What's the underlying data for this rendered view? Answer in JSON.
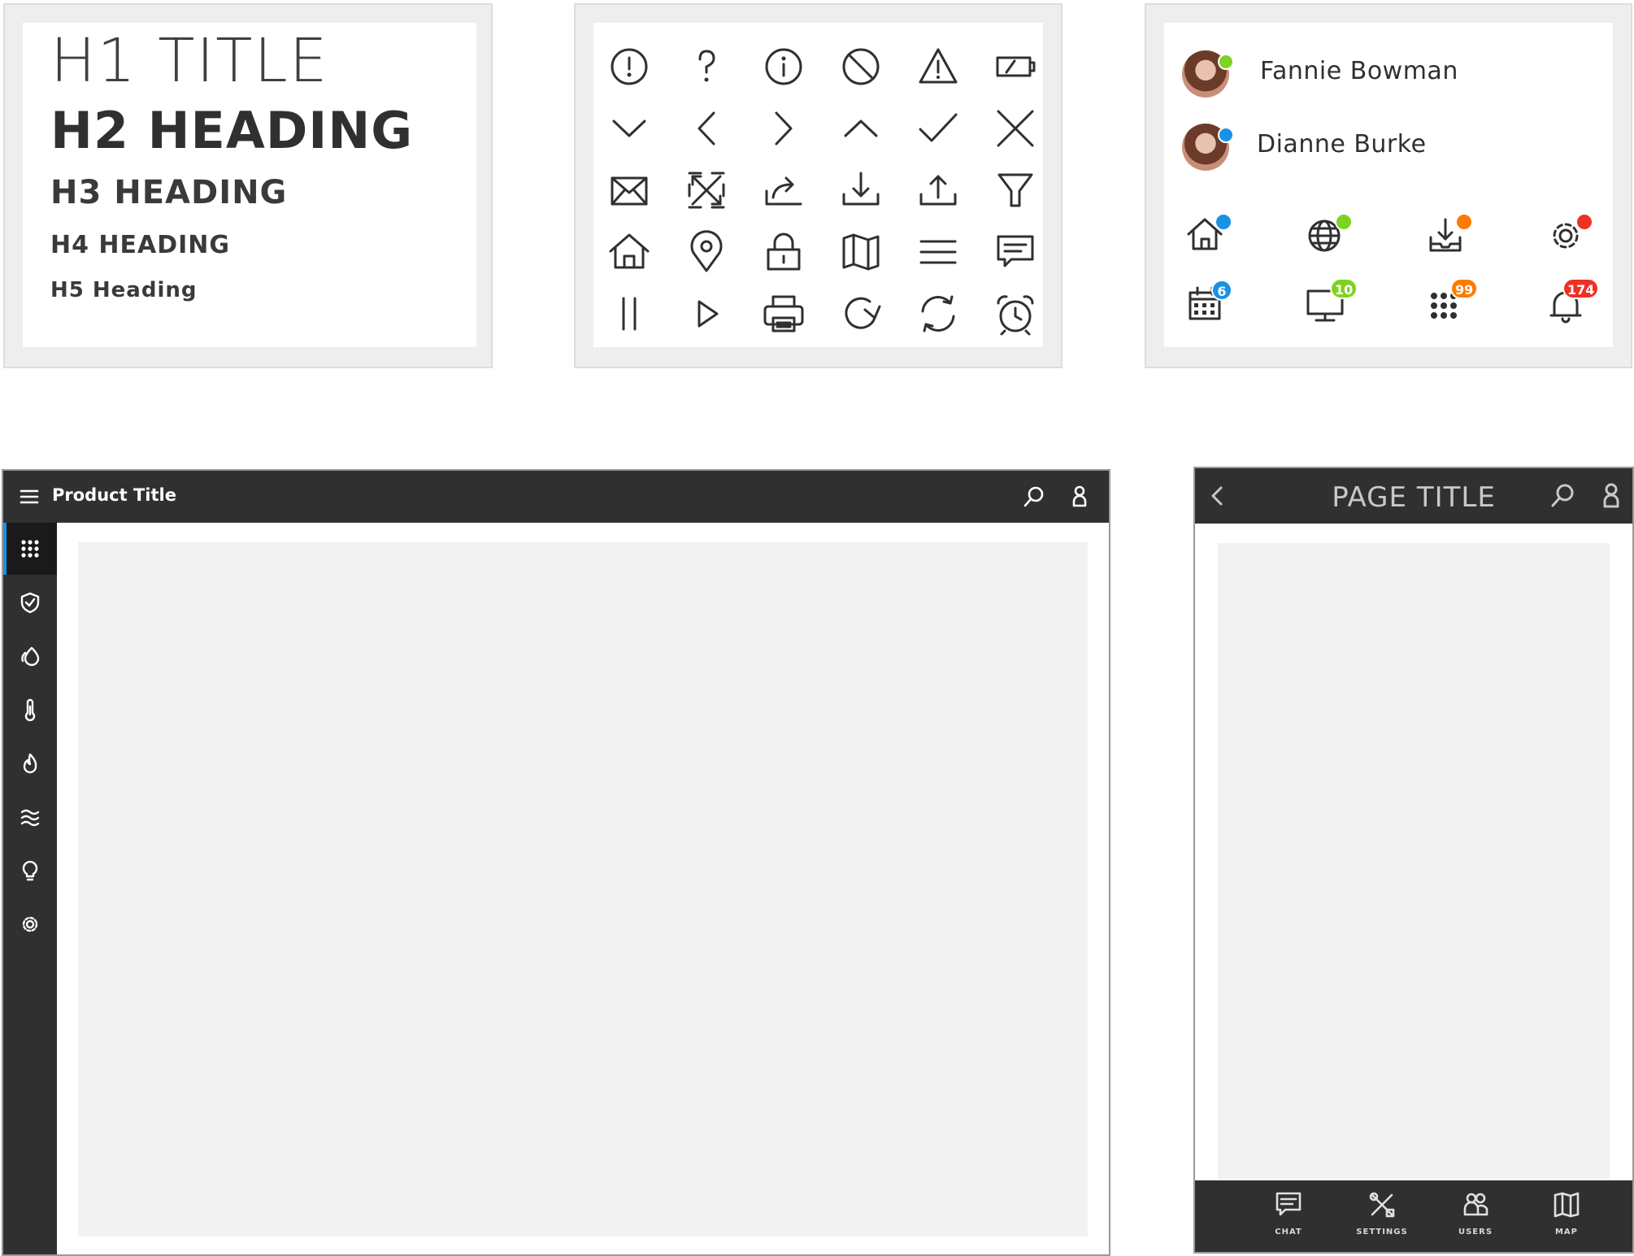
{
  "typography": {
    "h1": "H1 TITLE",
    "h2": "H2 HEADING",
    "h3": "H3 HEADING",
    "h4": "H4 HEADING",
    "h5": "H5 Heading"
  },
  "icon_grid": {
    "icons": [
      "alert-icon",
      "help-icon",
      "info-icon",
      "prohibited-icon",
      "warning-icon",
      "battery-low-icon",
      "chevron-down-icon",
      "chevron-left-icon",
      "chevron-right-icon",
      "chevron-up-icon",
      "check-icon",
      "close-icon",
      "mail-icon",
      "expand-icon",
      "share-icon",
      "download-icon",
      "upload-icon",
      "filter-icon",
      "home-icon",
      "location-pin-icon",
      "lock-icon",
      "map-icon",
      "menu-icon",
      "comment-icon",
      "pause-icon",
      "play-icon",
      "print-icon",
      "redo-icon",
      "refresh-icon",
      "alarm-clock-icon"
    ]
  },
  "users": [
    {
      "name": "Fannie Bowman",
      "status_color": "#7ed321"
    },
    {
      "name": "Dianne Burke",
      "status_color": "#1792e5"
    }
  ],
  "status_icons": [
    {
      "icon": "home-icon",
      "dot_color": "#1792e5"
    },
    {
      "icon": "globe-icon",
      "dot_color": "#7ed321"
    },
    {
      "icon": "inbox-download-icon",
      "dot_color": "#ff7a00"
    },
    {
      "icon": "gear-icon",
      "dot_color": "#ee3124"
    }
  ],
  "badge_icons": [
    {
      "icon": "calendar-icon",
      "count": "6",
      "color": "#1792e5"
    },
    {
      "icon": "monitor-icon",
      "count": "10",
      "color": "#7ed321"
    },
    {
      "icon": "apps-icon",
      "count": "99",
      "color": "#ff7a00"
    },
    {
      "icon": "bell-icon",
      "count": "174",
      "color": "#ee3124"
    }
  ],
  "desktop": {
    "title": "Product Title",
    "accent": "#1792e5",
    "sidebar": [
      "apps-icon",
      "shield-icon",
      "energy-icon",
      "thermometer-icon",
      "flame-icon",
      "waves-icon",
      "lightbulb-icon",
      "gear-icon"
    ]
  },
  "mobile": {
    "title": "PAGE TITLE",
    "nav": [
      {
        "icon": "chat-icon",
        "label": "CHAT"
      },
      {
        "icon": "settings-icon",
        "label": "SETTINGS"
      },
      {
        "icon": "users-icon",
        "label": "USERS"
      },
      {
        "icon": "map-icon",
        "label": "MAP"
      }
    ]
  }
}
